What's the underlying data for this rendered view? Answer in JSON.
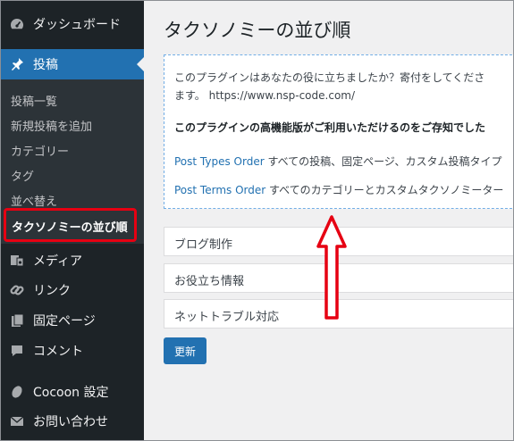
{
  "sidebar": {
    "dashboard_label": "ダッシュボード",
    "posts_label": "投稿",
    "posts_submenu": [
      "投稿一覧",
      "新規投稿を追加",
      "カテゴリー",
      "タグ",
      "並べ替え"
    ],
    "active_sub_label": "タクソノミーの並び順",
    "media_label": "メディア",
    "links_label": "リンク",
    "pages_label": "固定ページ",
    "comments_label": "コメント",
    "cocoon_label": "Cocoon 設定",
    "contact_label": "お問い合わせ"
  },
  "main": {
    "title": "タクソノミーの並び順",
    "notice": {
      "line1": "このプラグインはあなたの役に立ちましたか？寄付をしてくださ",
      "line2": "ます。 https://www.nsp-code.com/",
      "line3": "このプラグインの高機能版がご利用いただけるのをご存知でした",
      "link1": "Post Types Order",
      "line4_rest": " すべての投稿、固定ページ、カスタム投稿タイプ",
      "link2": "Post Terms Order",
      "line5_rest": " すべてのカテゴリーとカスタムタクソノミーター"
    },
    "taxonomies": [
      "ブログ制作",
      "お役立ち情報",
      "ネットトラブル対応"
    ],
    "update_label": "更新"
  },
  "colors": {
    "sidebar_bg": "#1d2327",
    "accent": "#2271b1",
    "highlight": "#e60012"
  }
}
